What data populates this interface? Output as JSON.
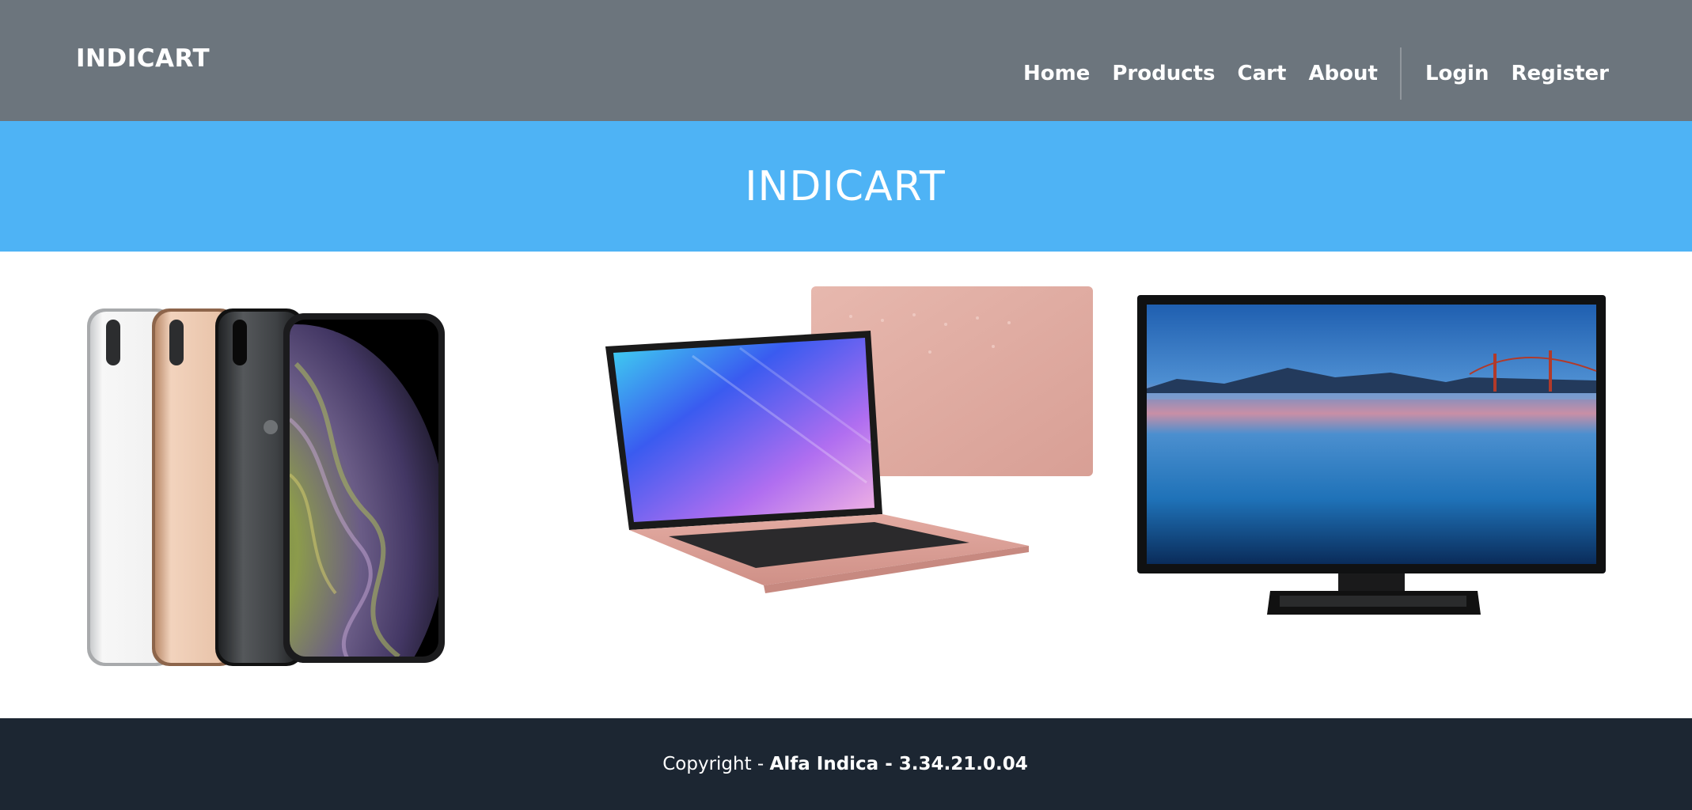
{
  "navbar": {
    "brand": "INDICART",
    "links": [
      "Home",
      "Products",
      "Cart",
      "About"
    ],
    "auth_links": [
      "Login",
      "Register"
    ]
  },
  "hero": {
    "title": "INDICART"
  },
  "products": [
    {
      "icon": "smartphone-image"
    },
    {
      "icon": "laptop-image"
    },
    {
      "icon": "television-image"
    }
  ],
  "footer": {
    "copyright_label": "Copyright - ",
    "company": "Alfa Indica",
    "separator": " - ",
    "version": "3.34.21.0.04"
  },
  "colors": {
    "navbar_bg": "#6c757d",
    "hero_bg": "#4eb3f5",
    "footer_bg": "#1c2632"
  }
}
